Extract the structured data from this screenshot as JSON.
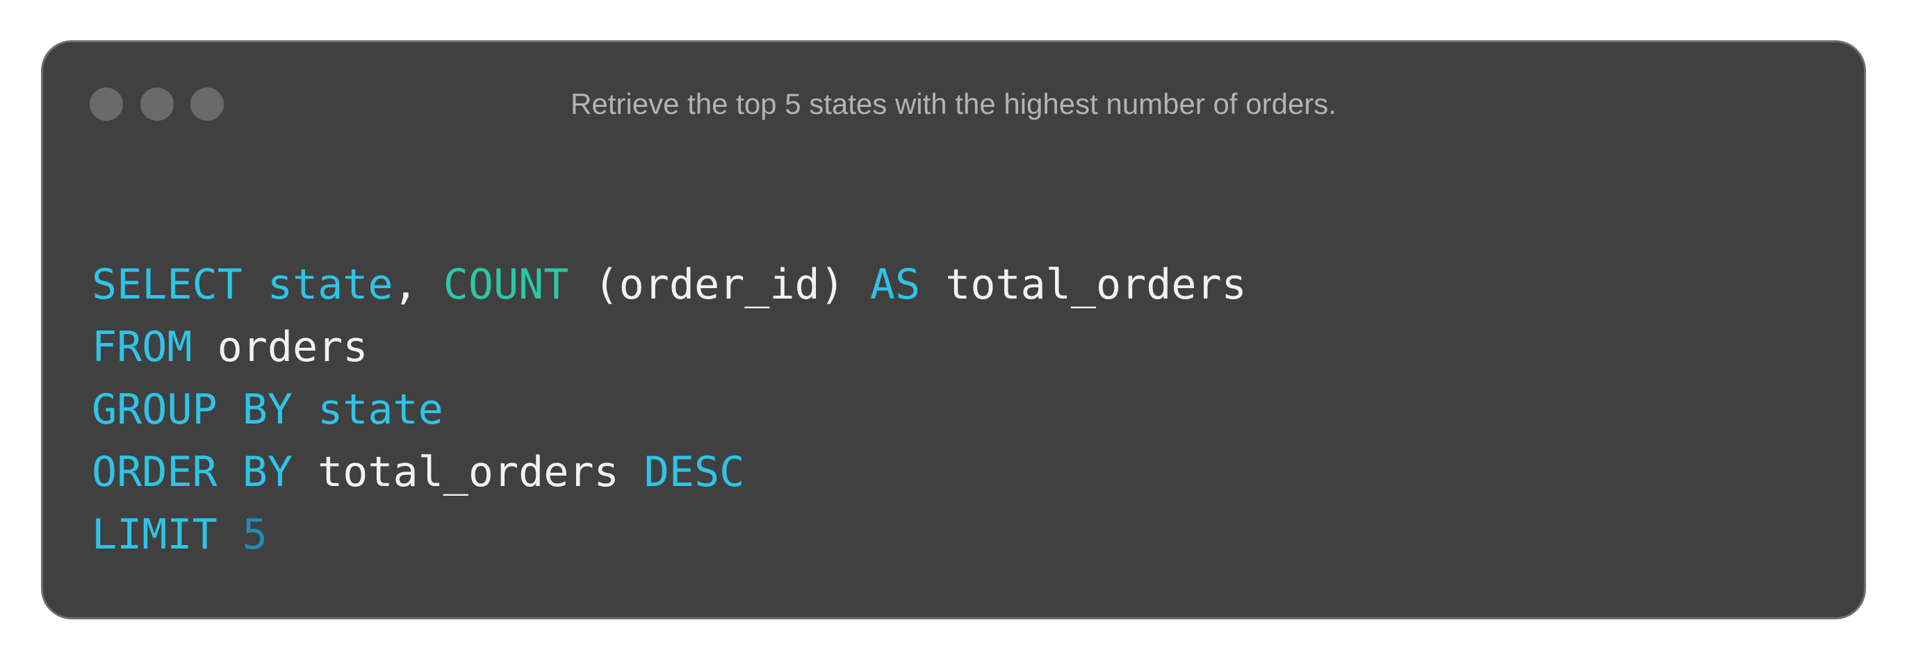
{
  "window": {
    "title": "Retrieve the top 5 states with the highest number of orders."
  },
  "colors": {
    "background": "#404040",
    "keyword": "#2ec4e8",
    "function": "#2bc7a6",
    "number": "#1b8fb8",
    "identifier": "#f2f2f2",
    "title": "#b3b3b3",
    "window_dot": "#6a6a6a"
  },
  "code": {
    "line1": {
      "kw1": "SELECT",
      "col": "state",
      "comma": ",",
      "fn": "COUNT",
      "arg": "(order_id)",
      "kw2": "AS",
      "alias": "total_orders"
    },
    "line2": {
      "kw": "FROM",
      "table": "orders"
    },
    "line3": {
      "kw": "GROUP BY",
      "col": "state"
    },
    "line4": {
      "kw1": "ORDER BY",
      "col": "total_orders",
      "kw2": "DESC"
    },
    "line5": {
      "kw": "LIMIT",
      "num": "5"
    }
  }
}
